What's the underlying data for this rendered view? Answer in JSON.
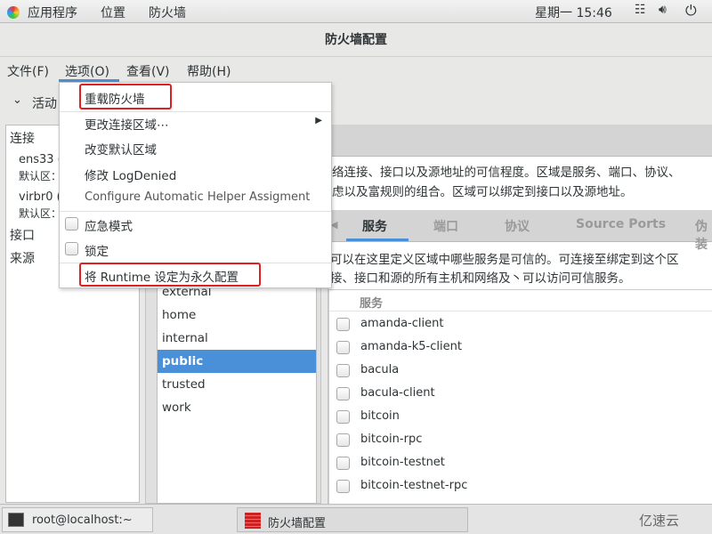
{
  "topbar": {
    "apps": "应用程序",
    "places": "位置",
    "app_name": "防火墙",
    "clock": "星期一 15:46",
    "icons": [
      "network-icon",
      "volume-icon",
      "power-icon"
    ]
  },
  "window": {
    "title": "防火墙配置"
  },
  "menubar": {
    "items": [
      "文件(F)",
      "选项(O)",
      "查看(V)",
      "帮助(H)"
    ]
  },
  "toolbar": {
    "active_binding": "活动"
  },
  "options_menu": {
    "items": [
      {
        "label": "重载防火墙",
        "highlighted": true
      },
      {
        "label": "更改连接区域⋯",
        "submenu": true
      },
      {
        "label": "改变默认区域"
      },
      {
        "label": "修改 LogDenied"
      },
      {
        "label": "Configure Automatic Helper Assigment"
      },
      {
        "label": "应急模式",
        "checkbox": true,
        "checked": false
      },
      {
        "label": "锁定",
        "checkbox": true,
        "checked": false
      },
      {
        "label": "将 Runtime 设定为永久配置",
        "highlighted": true
      }
    ]
  },
  "left_panel": {
    "connections_label": "连接",
    "connections": [
      {
        "name": "ens33 (",
        "zone": "默认区："
      },
      {
        "name": "virbr0 (",
        "zone": "默认区："
      }
    ],
    "interfaces_label": "接口",
    "sources_label": "来源"
  },
  "zones": {
    "items": [
      "external",
      "home",
      "internal",
      "public",
      "trusted",
      "work"
    ],
    "selected": "public"
  },
  "zone_description": [
    "络连接、接口以及源地址的可信程度。区域是服务、端口、协议、",
    "虑以及富规则的组合。区域可以绑定到接口以及源地址。"
  ],
  "tabs": {
    "items": [
      "服务",
      "端口",
      "协议",
      "Source Ports",
      "伪装"
    ],
    "active": "服务"
  },
  "services_description": [
    "可以在这里定义区域中哪些服务是可信的。可连接至绑定到这个区",
    "接、接口和源的所有主机和网络及丶可以访问可信服务。"
  ],
  "services": {
    "header": "服务",
    "items": [
      "amanda-client",
      "amanda-k5-client",
      "bacula",
      "bacula-client",
      "bitcoin",
      "bitcoin-rpc",
      "bitcoin-testnet",
      "bitcoin-testnet-rpc"
    ]
  },
  "taskbar": {
    "items": [
      "root@localhost:~",
      "防火墙配置"
    ],
    "watermark": "亿速云"
  },
  "colors": {
    "selection": "#4a90d9",
    "highlight_box": "#e02020"
  }
}
